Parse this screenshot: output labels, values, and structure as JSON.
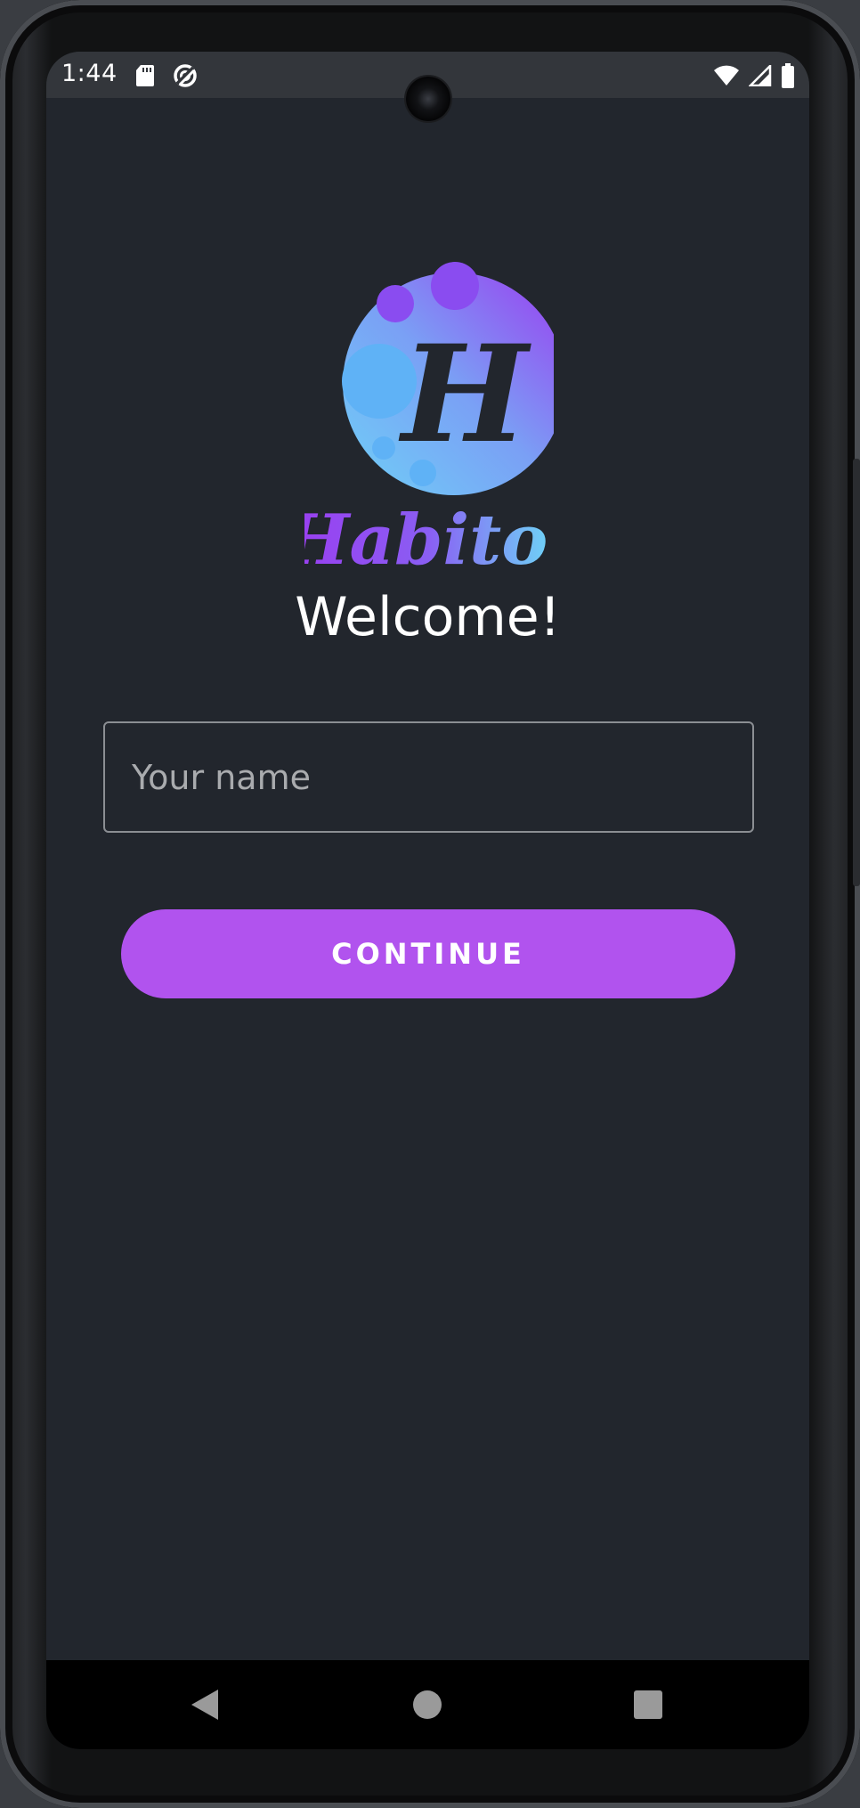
{
  "status_bar": {
    "time": "1:44",
    "left_icons": [
      "sd-card-icon",
      "data-saver-icon"
    ],
    "right_icons": [
      "wifi-icon",
      "cellular-signal-icon",
      "battery-icon"
    ]
  },
  "logo": {
    "letter": "H",
    "wordmark": "Habito",
    "gradient_colors": [
      "#9b3cf0",
      "#5ea8f5",
      "#6fd0f7"
    ]
  },
  "welcome": {
    "title": "Welcome!"
  },
  "name_field": {
    "placeholder": "Your name",
    "value": ""
  },
  "continue_button": {
    "label": "CONTINUE",
    "color": "#b153ee"
  },
  "nav_bar": {
    "buttons": [
      "back-icon",
      "home-icon",
      "recents-icon"
    ]
  },
  "colors": {
    "background": "#22262d",
    "status_bar": "#33363b",
    "accent": "#b153ee"
  }
}
